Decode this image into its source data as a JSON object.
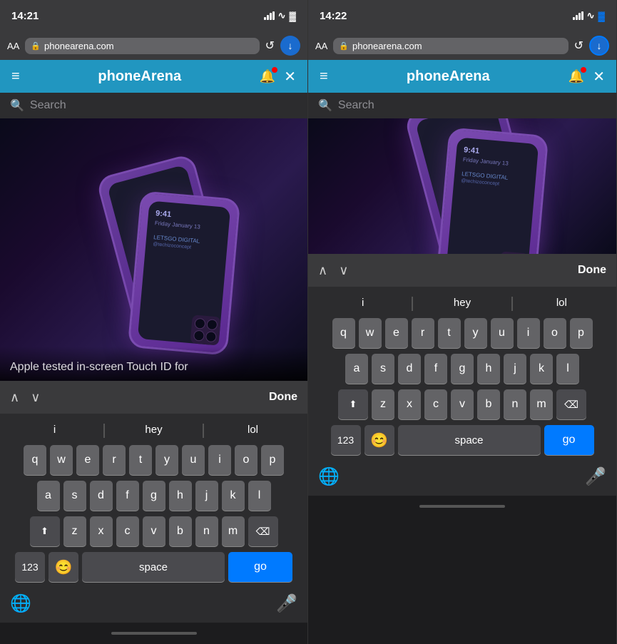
{
  "left": {
    "status": {
      "time": "14:21",
      "signal": "●●●",
      "wifi": "wifi",
      "battery": "battery"
    },
    "browser": {
      "aa": "AA",
      "url": "phonearena.com",
      "refresh": "↺"
    },
    "nav": {
      "title": "phoneArena",
      "hamburger": "≡",
      "close": "✕"
    },
    "search": {
      "placeholder": "Search"
    },
    "content": {
      "caption": "Apple tested in-screen Touch ID for"
    },
    "find": {
      "done": "Done"
    },
    "keyboard": {
      "suggestions": [
        "i",
        "hey",
        "lol"
      ],
      "row1": [
        "q",
        "w",
        "e",
        "r",
        "t",
        "y",
        "u",
        "i",
        "o",
        "p"
      ],
      "row2": [
        "a",
        "s",
        "d",
        "f",
        "g",
        "h",
        "j",
        "k",
        "l"
      ],
      "row3": [
        "z",
        "x",
        "c",
        "v",
        "b",
        "n",
        "m"
      ],
      "space_label": "space",
      "go_label": "go",
      "num_label": "123"
    }
  },
  "right": {
    "status": {
      "time": "14:22",
      "signal": "●●●",
      "wifi": "wifi",
      "battery": "battery"
    },
    "browser": {
      "aa": "AA",
      "url": "phonearena.com",
      "refresh": "↺"
    },
    "nav": {
      "title": "phoneArena",
      "hamburger": "≡",
      "close": "✕"
    },
    "search": {
      "placeholder": "Search"
    },
    "find": {
      "done": "Done"
    },
    "keyboard": {
      "suggestions": [
        "i",
        "hey",
        "lol"
      ],
      "row1": [
        "q",
        "w",
        "e",
        "r",
        "t",
        "y",
        "u",
        "i",
        "o",
        "p"
      ],
      "row2": [
        "a",
        "s",
        "d",
        "f",
        "g",
        "h",
        "j",
        "k",
        "l"
      ],
      "row3": [
        "z",
        "x",
        "c",
        "v",
        "b",
        "n",
        "m"
      ],
      "space_label": "space",
      "go_label": "go",
      "num_label": "123"
    }
  }
}
